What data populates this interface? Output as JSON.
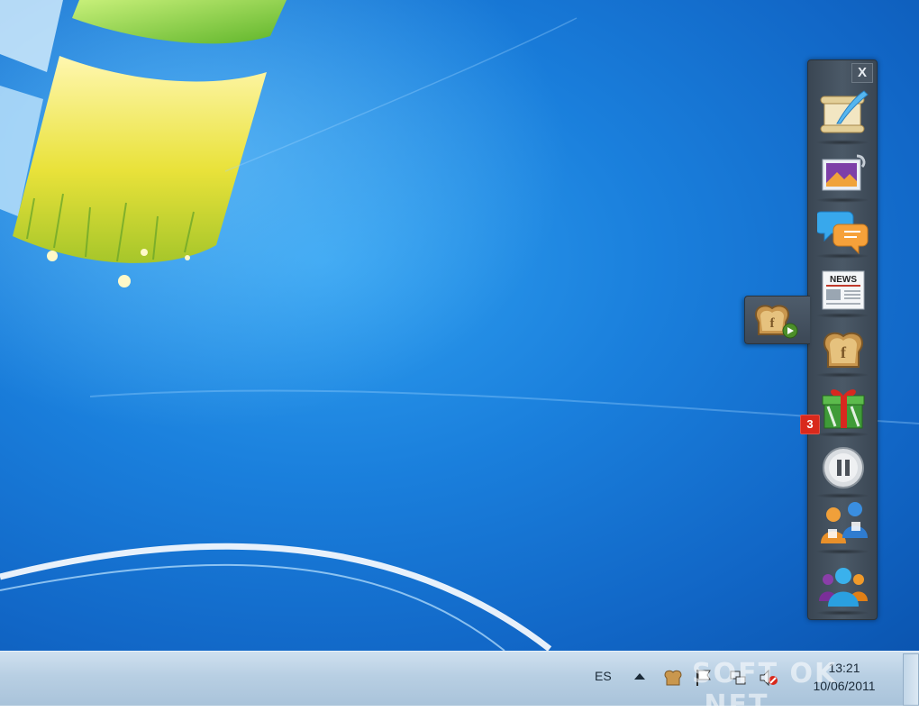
{
  "desktop": {
    "wallpaper": "windows-7-default"
  },
  "sidebar": {
    "close_label": "X",
    "items": [
      {
        "name": "post-icon",
        "label": "scroll-with-quill"
      },
      {
        "name": "photos-icon",
        "label": "photo-album"
      },
      {
        "name": "chat-icon",
        "label": "speech-bubbles"
      },
      {
        "name": "news-icon",
        "label": "newspaper"
      },
      {
        "name": "toast-icon",
        "label": "toast"
      },
      {
        "name": "gift-icon",
        "label": "gift"
      },
      {
        "name": "pause-icon",
        "label": "pause"
      },
      {
        "name": "friends-chat-icon",
        "label": "users-chatting"
      },
      {
        "name": "groups-icon",
        "label": "user-group"
      }
    ],
    "gift_badge": "3"
  },
  "flyout": {
    "icon": "toast-play-icon"
  },
  "taskbar": {
    "language": "ES",
    "clock_time": "13:21",
    "clock_date": "10/06/2011"
  },
  "watermark": "SOFT OK .NET",
  "colors": {
    "accent_blue": "#1a7fdc",
    "badge_red": "#d9291c",
    "sidebar_gray": "#4b5967"
  }
}
